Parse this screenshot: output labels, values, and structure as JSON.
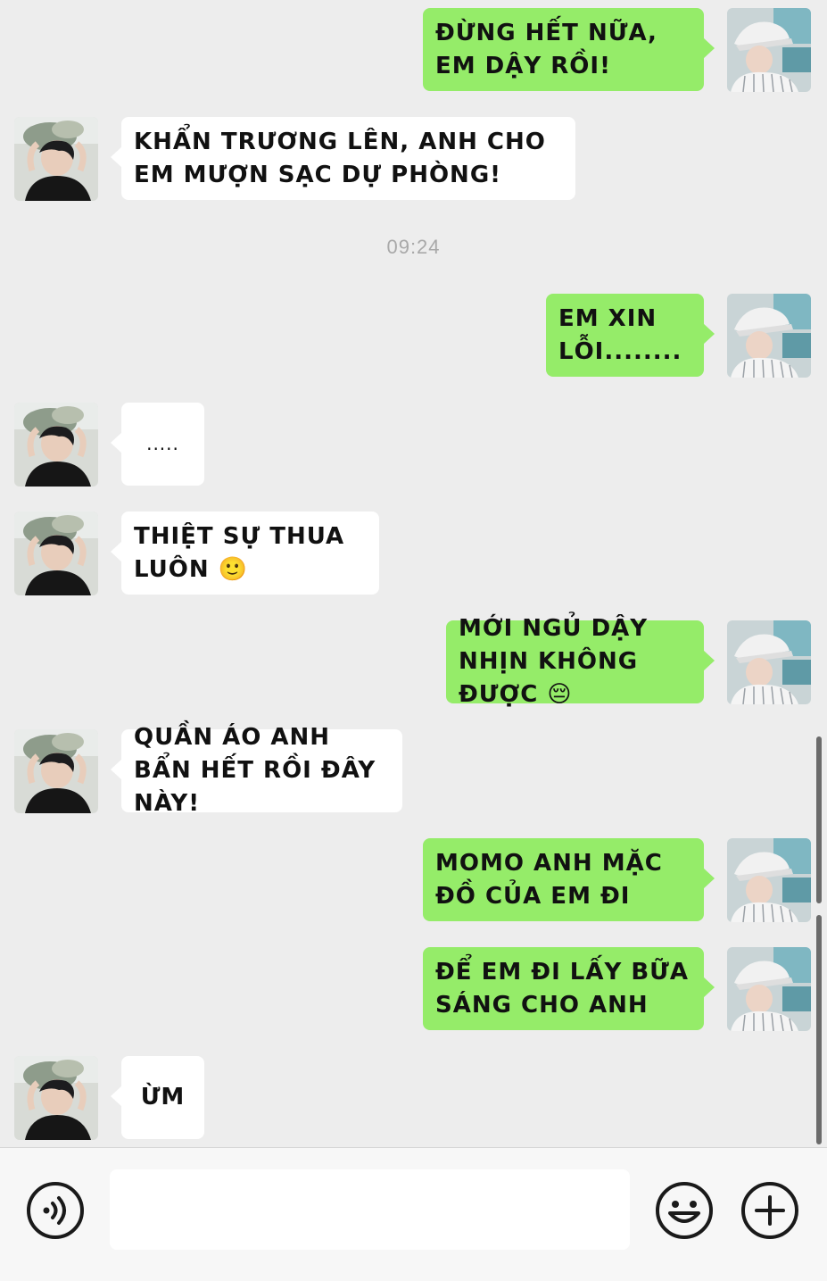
{
  "timestamp": "09:24",
  "messages": [
    {
      "side": "out",
      "text": "Đừng hết nữa, em dậy rồi!"
    },
    {
      "side": "in",
      "text": "Khẩn trương lên, anh cho em mượn sạc dự phòng!"
    },
    {
      "side": "out",
      "text": "Em xin lỗi........"
    },
    {
      "side": "in",
      "text": "....."
    },
    {
      "side": "in",
      "text": "Thiệt sự thua luôn 🙂"
    },
    {
      "side": "out",
      "text": "Mới ngủ dậy nhịn không được 😔"
    },
    {
      "side": "in",
      "text": "Quần áo anh bẩn hết rồi đây này!"
    },
    {
      "side": "out",
      "text": "Momo anh mặc đồ của em đi"
    },
    {
      "side": "out",
      "text": "Để em đi lấy bữa sáng cho anh"
    },
    {
      "side": "in",
      "text": "Ừm"
    }
  ],
  "input_bar": {
    "voice_icon": "voice-icon",
    "message_value": "",
    "emoji_icon": "emoji-icon",
    "plus_icon": "plus-icon"
  },
  "colors": {
    "background": "#ededed",
    "outgoing_bubble": "#95ec69",
    "incoming_bubble": "#ffffff",
    "timestamp": "#a9a9a9"
  }
}
